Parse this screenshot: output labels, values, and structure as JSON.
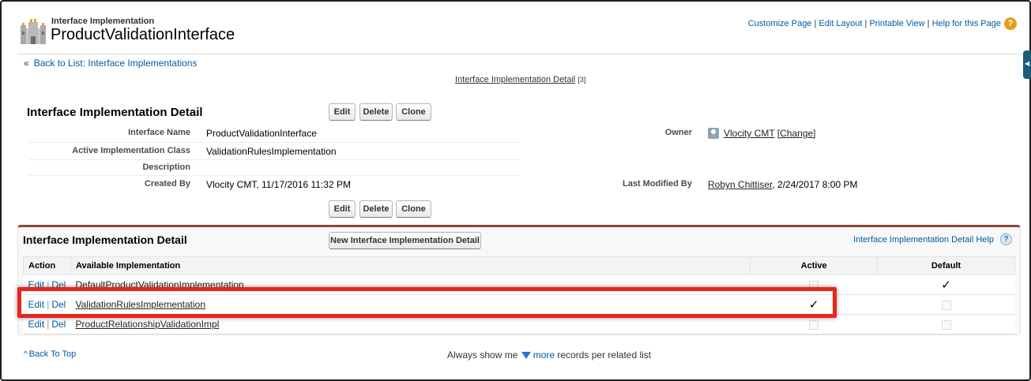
{
  "header": {
    "subtitle": "Interface Implementation",
    "title": "ProductValidationInterface",
    "links": [
      "Customize Page",
      "Edit Layout",
      "Printable View",
      "Help for this Page"
    ],
    "help_icon": "question-mark-icon"
  },
  "breadcrumb": {
    "prefix": "«",
    "back_label": "Back to List: Interface Implementations"
  },
  "related_hover": {
    "label": "Interface Implementation Detail",
    "count": "[3]"
  },
  "detail": {
    "title": "Interface Implementation Detail",
    "buttons": [
      "Edit",
      "Delete",
      "Clone"
    ],
    "fields": {
      "interface_name_label": "Interface Name",
      "interface_name": "ProductValidationInterface",
      "active_class_label": "Active Implementation Class",
      "active_class": "ValidationRulesImplementation",
      "description_label": "Description",
      "description": "",
      "created_by_label": "Created By",
      "created_by": "Vlocity CMT, 11/17/2016 11:32 PM",
      "owner_label": "Owner",
      "owner_name": "Vlocity CMT",
      "owner_change": "[Change]",
      "last_modified_label": "Last Modified By",
      "last_modified_name": "Robyn Chittiser",
      "last_modified_date": ", 2/24/2017 8:00 PM"
    }
  },
  "related_list": {
    "title": "Interface Implementation Detail",
    "new_button": "New Interface Implementation Detail",
    "help_label": "Interface Implementation Detail Help",
    "columns": [
      "Action",
      "Available Implementation",
      "Active",
      "Default"
    ],
    "edit_label": "Edit",
    "del_label": "Del",
    "pipe": "|",
    "rows": [
      {
        "name": "DefaultProductValidationImplementation",
        "active": false,
        "default": true
      },
      {
        "name": "ValidationRulesImplementation",
        "active": true,
        "default": false
      },
      {
        "name": "ProductRelationshipValidationImpl",
        "active": false,
        "default": false
      }
    ]
  },
  "footer": {
    "back_to_top": "Back To Top",
    "always_prefix": "Always show me",
    "more_label": "more",
    "always_suffix": "records per related list"
  },
  "colors": {
    "link": "#015ba7",
    "highlight": "#e8261b",
    "related_list_accent": "#8a4637",
    "help_badge": "#e89c1a"
  }
}
